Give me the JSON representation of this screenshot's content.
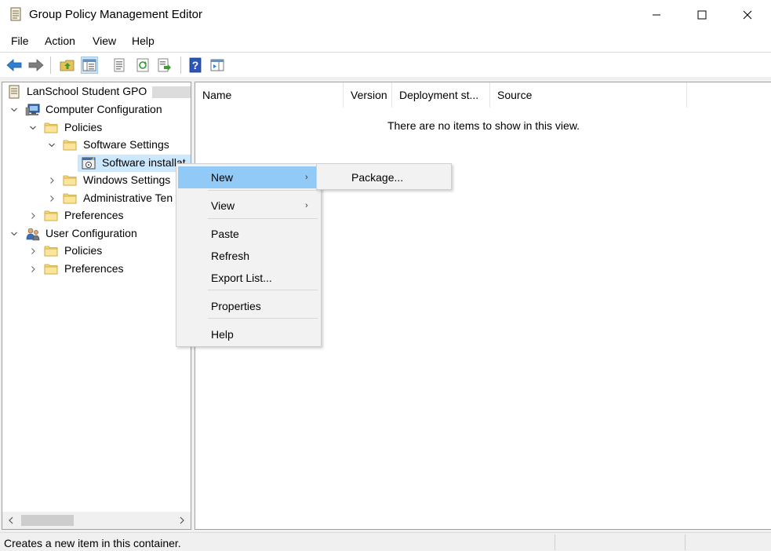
{
  "window": {
    "title": "Group Policy Management Editor",
    "accent": "#91c9f7"
  },
  "menubar": {
    "items": [
      "File",
      "Action",
      "View",
      "Help"
    ]
  },
  "toolbar": {
    "icons": [
      "back-arrow-icon",
      "forward-arrow-icon",
      "up-folder-icon",
      "show-hide-tree-icon",
      "properties-sheet-icon",
      "refresh-icon",
      "export-list-icon",
      "help-icon",
      "action-pane-icon"
    ]
  },
  "tree": {
    "root": "LanSchool Student GPO",
    "computer_config": "Computer Configuration",
    "cc_policies": "Policies",
    "software_settings": "Software Settings",
    "software_install": "Software installat",
    "windows_settings": "Windows Settings",
    "admin_templates": "Administrative Ten",
    "cc_preferences": "Preferences",
    "user_config": "User Configuration",
    "uc_policies": "Policies",
    "uc_preferences": "Preferences"
  },
  "list": {
    "columns": [
      "Name",
      "Version",
      "Deployment st...",
      "Source"
    ],
    "empty_message": "There are no items to show in this view."
  },
  "context_menu": {
    "new": "New",
    "view": "View",
    "paste": "Paste",
    "refresh": "Refresh",
    "export_list": "Export List...",
    "properties": "Properties",
    "help": "Help"
  },
  "submenu": {
    "package": "Package..."
  },
  "statusbar": {
    "text": "Creates a new item in this container."
  }
}
